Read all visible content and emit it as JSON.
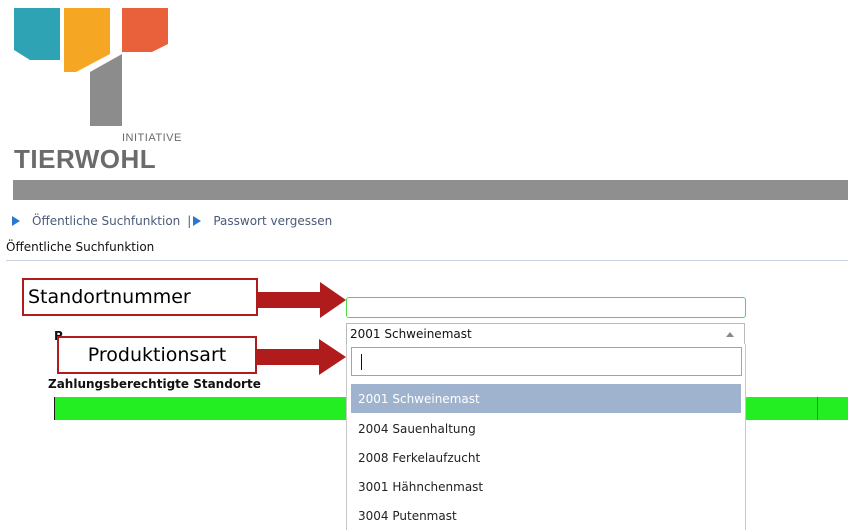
{
  "logo": {
    "initiative_text": "INITIATIVE",
    "brand_text": "TIERWOHL",
    "colors": [
      "#2ea3b4",
      "#f5a623",
      "#e8613b",
      "#8c8c8c"
    ]
  },
  "nav": {
    "link1": "Öffentliche Suchfunktion",
    "separator": "|",
    "link2": "Passwort vergessen",
    "icon": "triangle-right-icon"
  },
  "page_title": "Öffentliche Suchfunktion",
  "form": {
    "standort_value": "",
    "produktionsart_selected": "2001 Schweinemast",
    "search_value": "",
    "options": [
      "2001 Schweinemast",
      "2004 Sauenhaltung",
      "2008 Ferkelaufzucht",
      "3001 Hähnchenmast",
      "3004 Putenmast"
    ],
    "selected_index": 0
  },
  "partial_label": "P",
  "section_heading": "Zahlungsberechtigte Standorte",
  "annotations": {
    "callout1": "Standortnummer",
    "callout2": "Produktionsart",
    "color": "#b01c1c"
  }
}
